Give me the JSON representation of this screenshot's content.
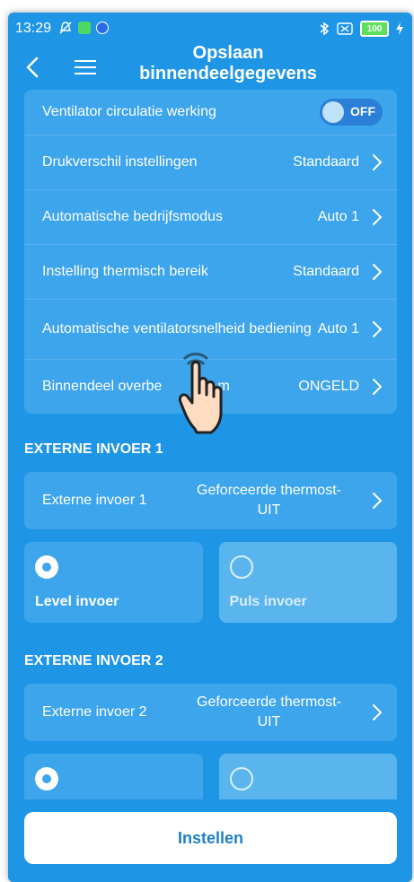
{
  "status": {
    "time": "13:29",
    "battery": "100"
  },
  "header": {
    "title_line1": "Opslaan",
    "title_line2": "binnendeelgegevens"
  },
  "settings": {
    "fan_circulation": {
      "label": "Ventilator circulatie werking",
      "toggle": "OFF"
    },
    "rows": [
      {
        "label": "Drukverschil instellingen",
        "value": "Standaard"
      },
      {
        "label": "Automatische bedrijfsmodus",
        "value": "Auto 1"
      },
      {
        "label": "Instelling thermisch bereik",
        "value": "Standaard"
      },
      {
        "label": "Automatische ventilatorsnelheid bediening",
        "value": "Auto 1"
      },
      {
        "label": "Binnendeel overbe",
        "label_tail": "m",
        "value": "ONGELD"
      }
    ]
  },
  "external1": {
    "section_title": "EXTERNE INVOER 1",
    "label": "Externe invoer 1",
    "value_line1": "Geforceerde thermost-",
    "value_line2": "UIT",
    "options": [
      {
        "label": "Level invoer",
        "selected": true
      },
      {
        "label": "Puls invoer",
        "selected": false
      }
    ]
  },
  "external2": {
    "section_title": "EXTERNE INVOER 2",
    "label": "Externe invoer 2",
    "value_line1": "Geforceerde thermost-",
    "value_line2": "UIT",
    "options": [
      {
        "selected": true
      },
      {
        "selected": false
      }
    ]
  },
  "footer": {
    "set_button": "Instellen"
  },
  "colors": {
    "background": "#1f95e6",
    "card": "#3da5ec",
    "button_text": "#1f7fc8"
  }
}
